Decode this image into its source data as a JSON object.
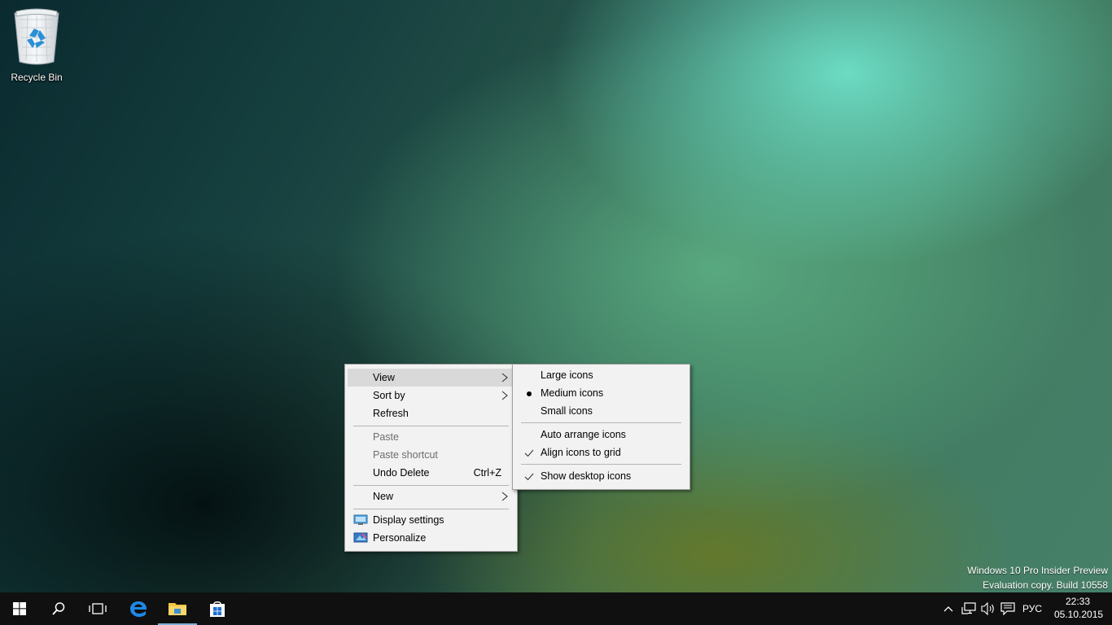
{
  "desktop": {
    "recycle_bin_label": "Recycle Bin"
  },
  "context_menu": {
    "items": [
      {
        "label": "View",
        "has_submenu": true,
        "highlighted": true
      },
      {
        "label": "Sort by",
        "has_submenu": true
      },
      {
        "label": "Refresh"
      },
      {
        "label": "Paste",
        "disabled": true
      },
      {
        "label": "Paste shortcut",
        "disabled": true
      },
      {
        "label": "Undo Delete",
        "shortcut": "Ctrl+Z"
      },
      {
        "label": "New",
        "has_submenu": true
      },
      {
        "label": "Display settings",
        "icon": "display-settings-icon"
      },
      {
        "label": "Personalize",
        "icon": "personalize-icon"
      }
    ]
  },
  "view_submenu": {
    "items": [
      {
        "label": "Large icons"
      },
      {
        "label": "Medium icons",
        "mark": "bullet"
      },
      {
        "label": "Small icons"
      },
      {
        "label": "Auto arrange icons"
      },
      {
        "label": "Align icons to grid",
        "mark": "check"
      },
      {
        "label": "Show desktop icons",
        "mark": "check"
      }
    ]
  },
  "watermark": {
    "line1": "Windows 10 Pro Insider Preview",
    "line2": "Evaluation copy. Build 10558"
  },
  "taskbar": {
    "buttons": [
      "start-icon",
      "search-icon",
      "task-view-icon",
      "edge-icon",
      "file-explorer-icon",
      "store-icon"
    ],
    "active_button": "file-explorer-icon",
    "tray": {
      "language": "РУС",
      "time": "22:33",
      "date": "05.10.2015"
    }
  },
  "colors": {
    "menu_bg": "#f2f2f2",
    "menu_highlight": "#d9d9d9",
    "taskbar_bg": "#101010",
    "active_indicator": "#7db1d6"
  }
}
